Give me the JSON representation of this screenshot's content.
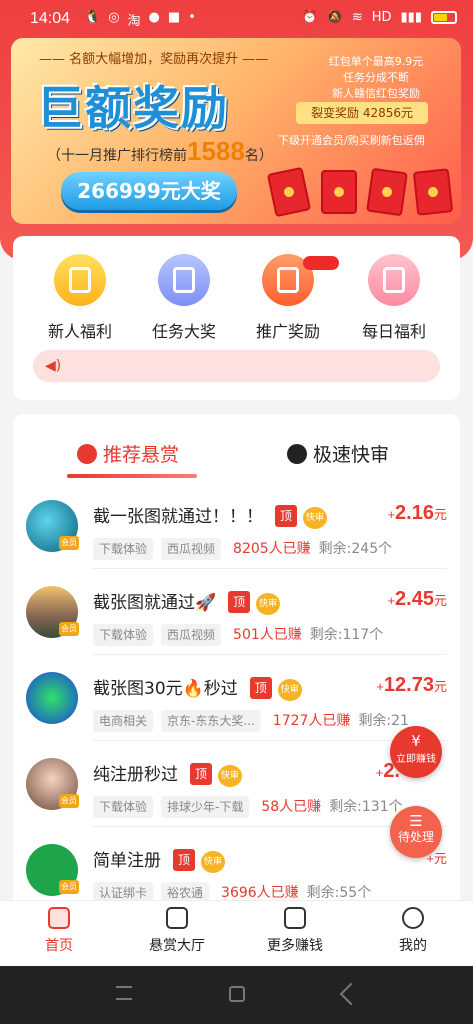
{
  "status_bar": {
    "time": "14:04",
    "left_icons": [
      "qq-icon",
      "app-icon",
      "taobao-icon",
      "app-icon",
      "app-icon",
      "dot"
    ],
    "right_icons": [
      "alarm-icon",
      "mute-icon",
      "wifi-icon",
      "hd-icon",
      "signal-icon",
      "battery-icon"
    ]
  },
  "banner": {
    "subtitle": "—— 名额大幅增加，奖励再次提升 ——",
    "headline": "巨额奖励",
    "rank_prefix": "（十一月推广排行榜前",
    "rank_number": "1588",
    "rank_suffix": "名）",
    "prize": "266999元大奖",
    "right_lines": [
      "红包单个最高9.9元",
      "任务分成不断",
      "新人赣信红包奖励"
    ],
    "fission": "裂变奖励 42856元",
    "bottom": "下级开通会员/购买刷新包返佣"
  },
  "categories": [
    {
      "label": "新人福利",
      "icon": "gift-icon"
    },
    {
      "label": "任务大奖",
      "icon": "clipboard-icon"
    },
    {
      "label": "推广奖励",
      "icon": "megaphone-icon"
    },
    {
      "label": "每日福利",
      "icon": "calendar-icon"
    }
  ],
  "tabs": [
    {
      "label": "推荐悬赏",
      "icon": "flame-icon",
      "active": true
    },
    {
      "label": "极速快审",
      "icon": "user-icon",
      "active": false
    }
  ],
  "tasks": [
    {
      "title": "截一张图就通过！！！",
      "top": "顶",
      "fast": "快审",
      "price_sign": "+",
      "price": "2.16",
      "unit": "元",
      "tags": [
        "下载体验",
        "西瓜视频"
      ],
      "earned": "8205人已赚",
      "remaining": "剩余:245个",
      "badge": "会员"
    },
    {
      "title": "截张图就通过🚀",
      "top": "顶",
      "fast": "快审",
      "price_sign": "+",
      "price": "2.45",
      "unit": "元",
      "tags": [
        "下载体验",
        "西瓜视频"
      ],
      "earned": "501人已赚",
      "remaining": "剩余:117个",
      "badge": "会员"
    },
    {
      "title": "截张图30元🔥秒过",
      "top": "顶",
      "fast": "快审",
      "price_sign": "+",
      "price": "12.73",
      "unit": "元",
      "tags": [
        "电商相关",
        "京东-东东大奖..."
      ],
      "earned": "1727人已赚",
      "remaining": "剩余:21",
      "badge": ""
    },
    {
      "title": "纯注册秒过",
      "top": "顶",
      "fast": "快审",
      "price_sign": "+",
      "price": "2.",
      "unit": "",
      "tags": [
        "下载体验",
        "排球少年-下载"
      ],
      "earned": "58人已赚",
      "remaining": "剩余:131个",
      "badge": "会员"
    },
    {
      "title": "简单注册",
      "top": "顶",
      "fast": "快审",
      "price_sign": "+",
      "price": "",
      "unit": "元",
      "tags": [
        "认证绑卡",
        "裕农通"
      ],
      "earned": "3696人已赚",
      "remaining": "剩余:55个",
      "badge": "会员"
    }
  ],
  "floating": {
    "earn_label": "立即赚钱",
    "earn_glyph": "¥",
    "pending_label": "待处理"
  },
  "bottom_nav": [
    {
      "label": "首页",
      "icon": "home-icon",
      "active": true
    },
    {
      "label": "悬赏大厅",
      "icon": "reward-hall-icon",
      "active": false
    },
    {
      "label": "更多赚钱",
      "icon": "gamepad-icon",
      "active": false
    },
    {
      "label": "我的",
      "icon": "profile-icon",
      "active": false
    }
  ],
  "colors": {
    "accent": "#e8392f",
    "banner_blue": "#1f8fd8",
    "gold": "#f7b324"
  }
}
